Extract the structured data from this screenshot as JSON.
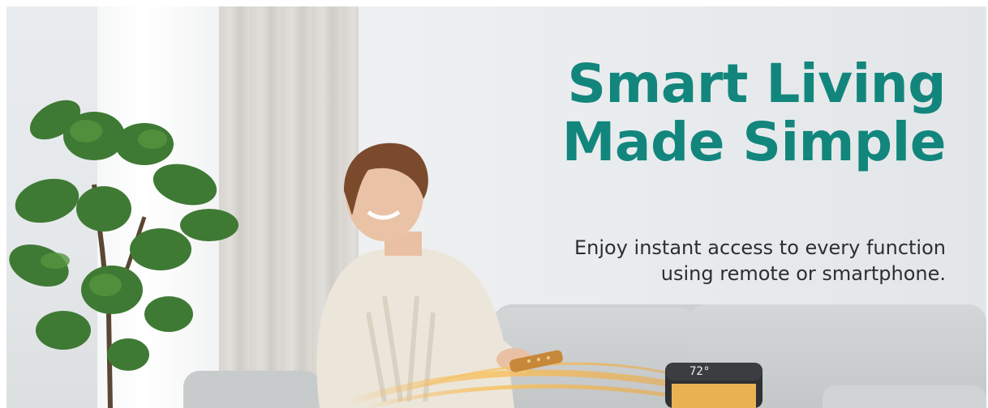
{
  "banner": {
    "headline_line1": "Smart Living",
    "headline_line2": "Made Simple",
    "subcopy_line1": "Enjoy instant access to every function",
    "subcopy_line2": "using remote or smartphone."
  },
  "heater": {
    "display_value": "72°"
  },
  "colors": {
    "headline": "#12867d",
    "body_text": "#2b2f33",
    "wall": "#e8ebed",
    "sofa": "#cdd0d1"
  },
  "icons": [
    "plant-illustration",
    "person-illustration",
    "remote-icon",
    "heater-icon",
    "warm-glow-effect"
  ]
}
